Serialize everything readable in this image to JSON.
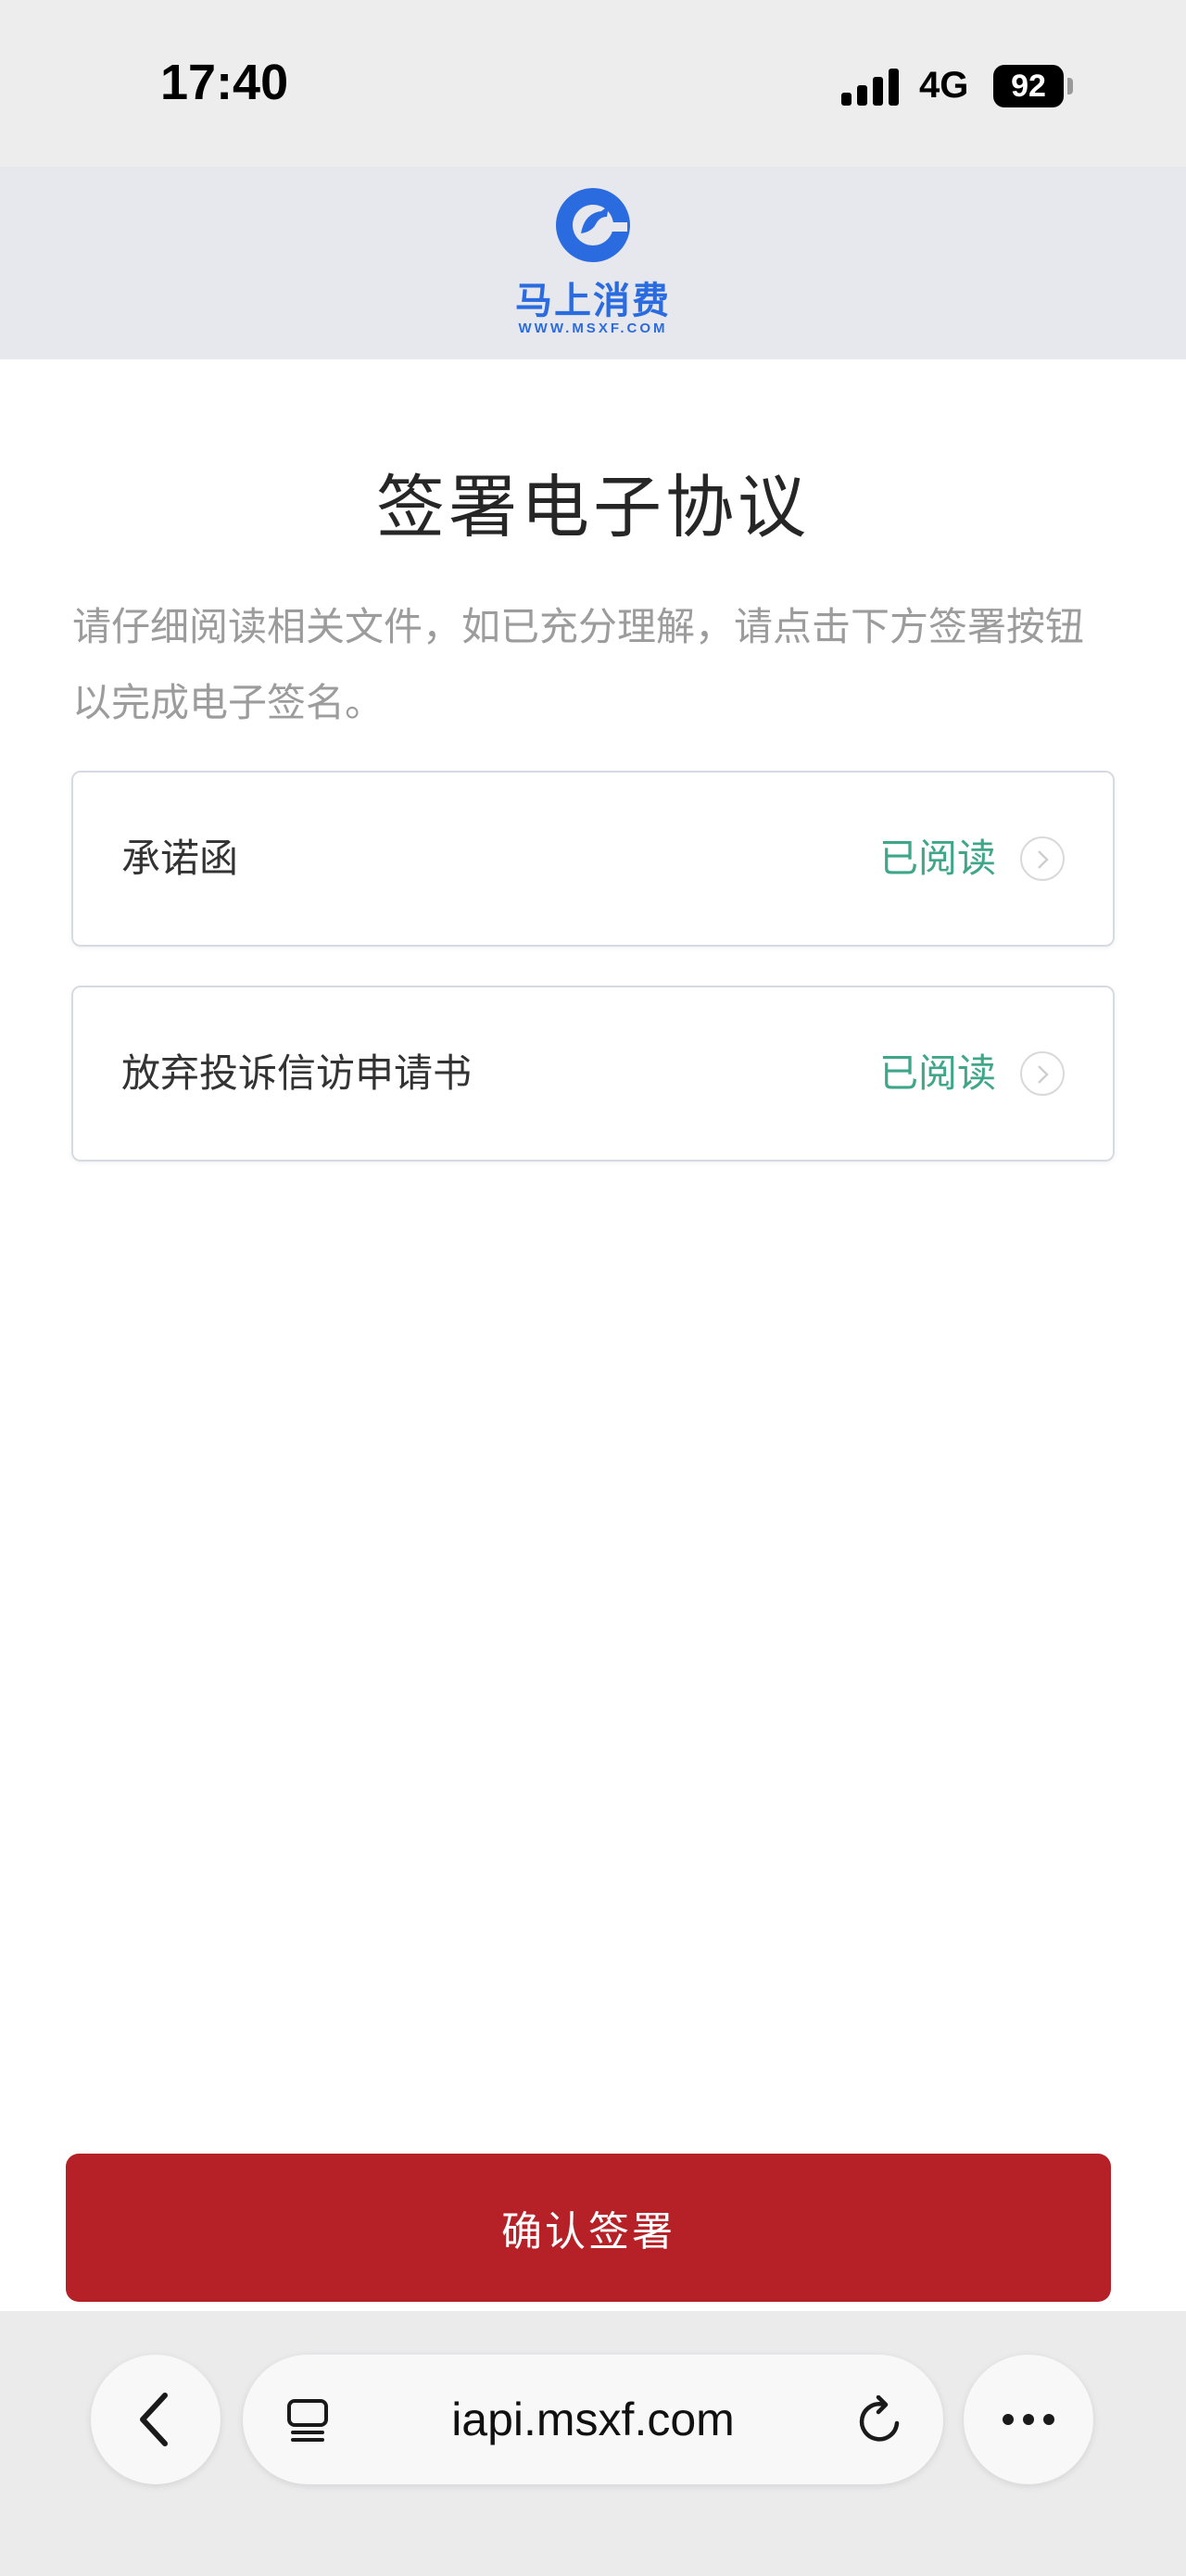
{
  "status_bar": {
    "time": "17:40",
    "network": "4G",
    "battery": "92"
  },
  "brand": {
    "name": "马上消费",
    "url": "WWW.MSXF.COM",
    "color": "#2b6be0"
  },
  "page": {
    "title": "签署电子协议",
    "intro": "请仔细阅读相关文件，如已充分理解，请点击下方签署按钮以完成电子签名。"
  },
  "documents": [
    {
      "title": "承诺函",
      "status": "已阅读"
    },
    {
      "title": "放弃投诉信访申请书",
      "status": "已阅读"
    }
  ],
  "confirm_button": {
    "label": "确认签署",
    "color": "#b52127"
  },
  "browser": {
    "url": "iapi.msxf.com",
    "icons": [
      "chevron-left-icon",
      "tabs-icon",
      "reload-icon",
      "more-icon"
    ]
  }
}
